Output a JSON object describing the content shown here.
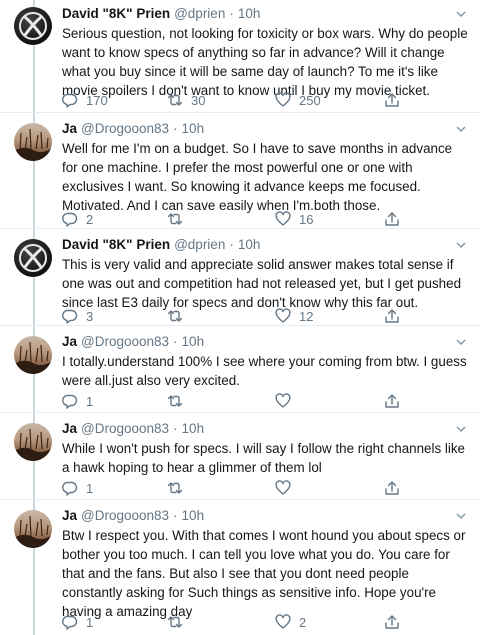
{
  "tweets": [
    {
      "name": "David \"8K\" Prien",
      "handle": "@dprien",
      "sep": "·",
      "time": "10h",
      "text": "Serious question, not looking for toxicity or box wars. Why do people want to know specs of anything so far in advance? Will it change what you buy since it will be same day of launch? To me it's like movie spoilers I don't want to know until I buy my movie ticket.",
      "replies": "170",
      "retweets": "30",
      "likes": "250",
      "avatar": "xbox-logo"
    },
    {
      "name": "Ja",
      "handle": "@Drogooon83",
      "sep": "·",
      "time": "10h",
      "text": "Well for me I'm on a budget. So I have to save months in advance for one machine. I prefer the most powerful one or one with exclusives I want. So knowing it advance keeps me focused. Motivated. And I can save easily when I'm.both those.",
      "replies": "2",
      "retweets": "",
      "likes": "16",
      "avatar": "dusk-photo"
    },
    {
      "name": "David \"8K\" Prien",
      "handle": "@dprien",
      "sep": "·",
      "time": "10h",
      "text": "This is very valid and appreciate solid answer makes total sense if one was out and competition had not released yet, but I get pushed since last E3 daily for specs and don't know why this far out.",
      "replies": "3",
      "retweets": "",
      "likes": "12",
      "avatar": "xbox-logo"
    },
    {
      "name": "Ja",
      "handle": "@Drogooon83",
      "sep": "·",
      "time": "10h",
      "text": "I totally.understand 100% I see where your coming from btw. I guess were all.just also very excited.",
      "replies": "1",
      "retweets": "",
      "likes": "",
      "avatar": "dusk-photo"
    },
    {
      "name": "Ja",
      "handle": "@Drogooon83",
      "sep": "·",
      "time": "10h",
      "text": "While I won't push for specs. I will say I follow the right channels like a hawk hoping to hear a glimmer of them lol",
      "replies": "1",
      "retweets": "",
      "likes": "",
      "avatar": "dusk-photo"
    },
    {
      "name": "Ja",
      "handle": "@Drogooon83",
      "sep": "·",
      "time": "10h",
      "text": "Btw I respect you. With that comes I wont hound you about specs or bother you too much. I can tell you love what you do. You care for that and the fans. But also I see that you dont need people constantly asking for Such things as sensitive info. Hope you're having a amazing day",
      "replies": "1",
      "retweets": "",
      "likes": "2",
      "avatar": "dusk-photo"
    }
  ],
  "colors": {
    "text": "#14171a",
    "muted": "#657786",
    "divider": "#e6ecf0",
    "thread_line": "#ccd6dd"
  },
  "icons": [
    "reply-icon",
    "retweet-icon",
    "like-icon",
    "share-icon",
    "caret-down-icon"
  ]
}
